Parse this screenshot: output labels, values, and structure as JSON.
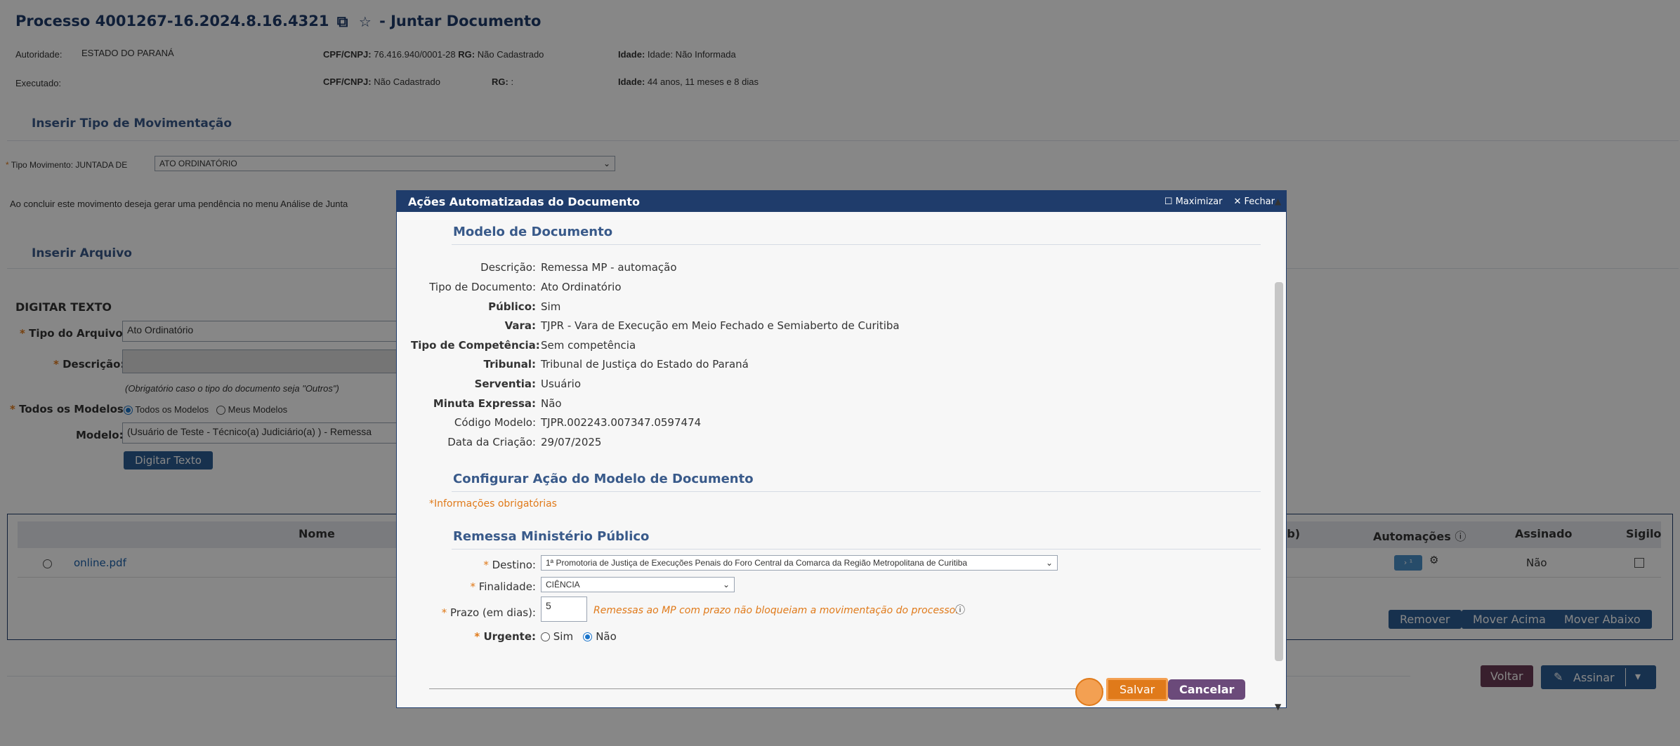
{
  "page": {
    "title": "Processo 4001267-16.2024.8.16.4321",
    "title_suffix": "- Juntar Documento"
  },
  "parties": [
    {
      "role": "Autoridade:",
      "name": "ESTADO DO PARANÁ",
      "cpf_label": "CPF/CNPJ:",
      "cpf_value": "76.416.940/0001-28",
      "rg_label": "RG:",
      "rg_value": "Não Cadastrado",
      "age_label": "Idade:",
      "age_value": "Idade: Não Informada"
    },
    {
      "role": "Executado:",
      "name": "",
      "cpf_label": "CPF/CNPJ:",
      "cpf_value": "Não Cadastrado",
      "rg_label": "RG:",
      "rg_value": ":",
      "age_label": "Idade:",
      "age_value": "44 anos, 11 meses e 8 dias"
    }
  ],
  "movimentacao": {
    "section_title": "Inserir Tipo de Movimentação",
    "tipo_label": "Tipo Movimento:",
    "tipo_prefix": "JUNTADA DE",
    "tipo_value": "ATO ORDINATÓRIO",
    "pendencia_text": "Ao concluir este movimento deseja gerar uma pendência no menu Análise de Junta"
  },
  "arquivo": {
    "section_title": "Inserir Arquivo",
    "digitar_title": "DIGITAR TEXTO",
    "tipo_label": "Tipo do Arquivo:",
    "tipo_value": "Ato Ordinatório",
    "descricao_label": "Descrição:",
    "descricao_hint": "(Obrigatório caso o tipo do documento seja \"Outros\")",
    "modelos_label": "Todos os Modelos:",
    "modelos_opt1": "Todos os Modelos",
    "modelos_opt2": "Meus Modelos",
    "modelo_label": "Modelo:",
    "modelo_value": "(Usuário de Teste - Técnico(a) Judiciário(a) ) - Remessa",
    "digitar_button": "Digitar Texto"
  },
  "table": {
    "headers": [
      "Nome",
      "(b)",
      "Automações",
      "Assinado",
      "Sigilo"
    ],
    "rows": [
      {
        "name": "online.pdf",
        "assinado": "Não"
      }
    ],
    "buttons": [
      "Remover",
      "Mover Acima",
      "Mover Abaixo"
    ]
  },
  "footer": {
    "voltar": "Voltar",
    "assinar": "Assinar"
  },
  "modal": {
    "title": "Ações Automatizadas do Documento",
    "maximizar": "Maximizar",
    "fechar": "Fechar",
    "modelo_section": "Modelo de Documento",
    "fields": [
      {
        "label": "Descrição:",
        "value": "Remessa MP - automação",
        "bold": false
      },
      {
        "label": "Tipo de Documento:",
        "value": "Ato Ordinatório",
        "bold": false
      },
      {
        "label": "Público:",
        "value": "Sim",
        "bold": true
      },
      {
        "label": "Vara:",
        "value": "TJPR - Vara de Execução em Meio Fechado e Semiaberto de Curitiba",
        "bold": true
      },
      {
        "label": "Tipo de Competência:",
        "value": "Sem competência",
        "bold": true
      },
      {
        "label": "Tribunal:",
        "value": "Tribunal de Justiça do Estado do Paraná",
        "bold": true
      },
      {
        "label": "Serventia:",
        "value": "Usuário",
        "bold": true
      },
      {
        "label": "Minuta Expressa:",
        "value": "Não",
        "bold": true
      },
      {
        "label": "Código Modelo:",
        "value": "TJPR.002243.007347.0597474",
        "bold": false
      },
      {
        "label": "Data da Criação:",
        "value": "29/07/2025",
        "bold": false
      }
    ],
    "configurar_section": "Configurar Ação do Modelo de Documento",
    "obrigatorias": "Informações obrigatórias",
    "remessa_section": "Remessa Ministério Público",
    "destino_label": "Destino:",
    "destino_value": "1ª Promotoria de Justiça de Execuções Penais do Foro Central da Comarca da Região Metropolitana de Curitiba",
    "finalidade_label": "Finalidade:",
    "finalidade_value": "CIÊNCIA",
    "prazo_label": "Prazo (em dias):",
    "prazo_value": "5",
    "prazo_note": "Remessas ao MP com prazo não bloqueiam a movimentação do processo.",
    "urgente_label": "Urgente:",
    "urgente_sim": "Sim",
    "urgente_nao": "Não",
    "salvar": "Salvar",
    "cancelar": "Cancelar"
  },
  "colors": {
    "primary": "#1f3c6b",
    "section": "#395a8a",
    "required": "#e07a1a",
    "button_blue": "#2c5d93",
    "salvar": "#e07a1a",
    "cancelar": "#6b4a7a"
  }
}
